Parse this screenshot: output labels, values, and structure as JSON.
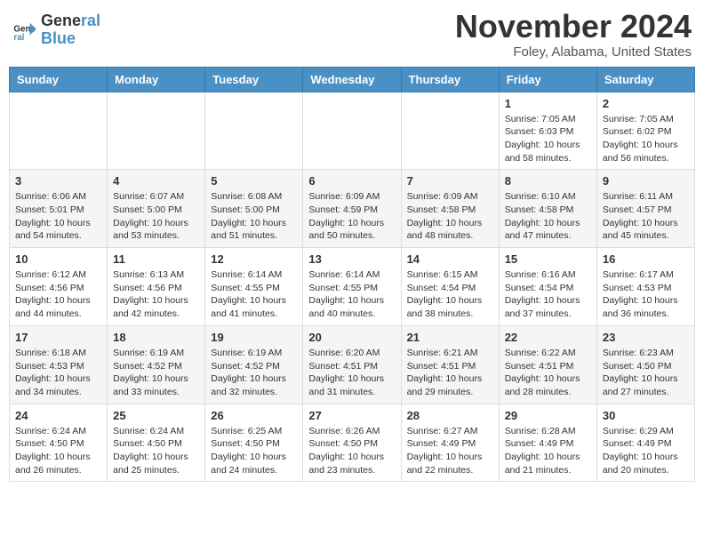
{
  "header": {
    "logo_line1": "General",
    "logo_line2": "Blue",
    "month": "November 2024",
    "location": "Foley, Alabama, United States"
  },
  "weekdays": [
    "Sunday",
    "Monday",
    "Tuesday",
    "Wednesday",
    "Thursday",
    "Friday",
    "Saturday"
  ],
  "weeks": [
    [
      {
        "day": "",
        "info": ""
      },
      {
        "day": "",
        "info": ""
      },
      {
        "day": "",
        "info": ""
      },
      {
        "day": "",
        "info": ""
      },
      {
        "day": "",
        "info": ""
      },
      {
        "day": "1",
        "info": "Sunrise: 7:05 AM\nSunset: 6:03 PM\nDaylight: 10 hours and 58 minutes."
      },
      {
        "day": "2",
        "info": "Sunrise: 7:05 AM\nSunset: 6:02 PM\nDaylight: 10 hours and 56 minutes."
      }
    ],
    [
      {
        "day": "3",
        "info": "Sunrise: 6:06 AM\nSunset: 5:01 PM\nDaylight: 10 hours and 54 minutes."
      },
      {
        "day": "4",
        "info": "Sunrise: 6:07 AM\nSunset: 5:00 PM\nDaylight: 10 hours and 53 minutes."
      },
      {
        "day": "5",
        "info": "Sunrise: 6:08 AM\nSunset: 5:00 PM\nDaylight: 10 hours and 51 minutes."
      },
      {
        "day": "6",
        "info": "Sunrise: 6:09 AM\nSunset: 4:59 PM\nDaylight: 10 hours and 50 minutes."
      },
      {
        "day": "7",
        "info": "Sunrise: 6:09 AM\nSunset: 4:58 PM\nDaylight: 10 hours and 48 minutes."
      },
      {
        "day": "8",
        "info": "Sunrise: 6:10 AM\nSunset: 4:58 PM\nDaylight: 10 hours and 47 minutes."
      },
      {
        "day": "9",
        "info": "Sunrise: 6:11 AM\nSunset: 4:57 PM\nDaylight: 10 hours and 45 minutes."
      }
    ],
    [
      {
        "day": "10",
        "info": "Sunrise: 6:12 AM\nSunset: 4:56 PM\nDaylight: 10 hours and 44 minutes."
      },
      {
        "day": "11",
        "info": "Sunrise: 6:13 AM\nSunset: 4:56 PM\nDaylight: 10 hours and 42 minutes."
      },
      {
        "day": "12",
        "info": "Sunrise: 6:14 AM\nSunset: 4:55 PM\nDaylight: 10 hours and 41 minutes."
      },
      {
        "day": "13",
        "info": "Sunrise: 6:14 AM\nSunset: 4:55 PM\nDaylight: 10 hours and 40 minutes."
      },
      {
        "day": "14",
        "info": "Sunrise: 6:15 AM\nSunset: 4:54 PM\nDaylight: 10 hours and 38 minutes."
      },
      {
        "day": "15",
        "info": "Sunrise: 6:16 AM\nSunset: 4:54 PM\nDaylight: 10 hours and 37 minutes."
      },
      {
        "day": "16",
        "info": "Sunrise: 6:17 AM\nSunset: 4:53 PM\nDaylight: 10 hours and 36 minutes."
      }
    ],
    [
      {
        "day": "17",
        "info": "Sunrise: 6:18 AM\nSunset: 4:53 PM\nDaylight: 10 hours and 34 minutes."
      },
      {
        "day": "18",
        "info": "Sunrise: 6:19 AM\nSunset: 4:52 PM\nDaylight: 10 hours and 33 minutes."
      },
      {
        "day": "19",
        "info": "Sunrise: 6:19 AM\nSunset: 4:52 PM\nDaylight: 10 hours and 32 minutes."
      },
      {
        "day": "20",
        "info": "Sunrise: 6:20 AM\nSunset: 4:51 PM\nDaylight: 10 hours and 31 minutes."
      },
      {
        "day": "21",
        "info": "Sunrise: 6:21 AM\nSunset: 4:51 PM\nDaylight: 10 hours and 29 minutes."
      },
      {
        "day": "22",
        "info": "Sunrise: 6:22 AM\nSunset: 4:51 PM\nDaylight: 10 hours and 28 minutes."
      },
      {
        "day": "23",
        "info": "Sunrise: 6:23 AM\nSunset: 4:50 PM\nDaylight: 10 hours and 27 minutes."
      }
    ],
    [
      {
        "day": "24",
        "info": "Sunrise: 6:24 AM\nSunset: 4:50 PM\nDaylight: 10 hours and 26 minutes."
      },
      {
        "day": "25",
        "info": "Sunrise: 6:24 AM\nSunset: 4:50 PM\nDaylight: 10 hours and 25 minutes."
      },
      {
        "day": "26",
        "info": "Sunrise: 6:25 AM\nSunset: 4:50 PM\nDaylight: 10 hours and 24 minutes."
      },
      {
        "day": "27",
        "info": "Sunrise: 6:26 AM\nSunset: 4:50 PM\nDaylight: 10 hours and 23 minutes."
      },
      {
        "day": "28",
        "info": "Sunrise: 6:27 AM\nSunset: 4:49 PM\nDaylight: 10 hours and 22 minutes."
      },
      {
        "day": "29",
        "info": "Sunrise: 6:28 AM\nSunset: 4:49 PM\nDaylight: 10 hours and 21 minutes."
      },
      {
        "day": "30",
        "info": "Sunrise: 6:29 AM\nSunset: 4:49 PM\nDaylight: 10 hours and 20 minutes."
      }
    ]
  ]
}
